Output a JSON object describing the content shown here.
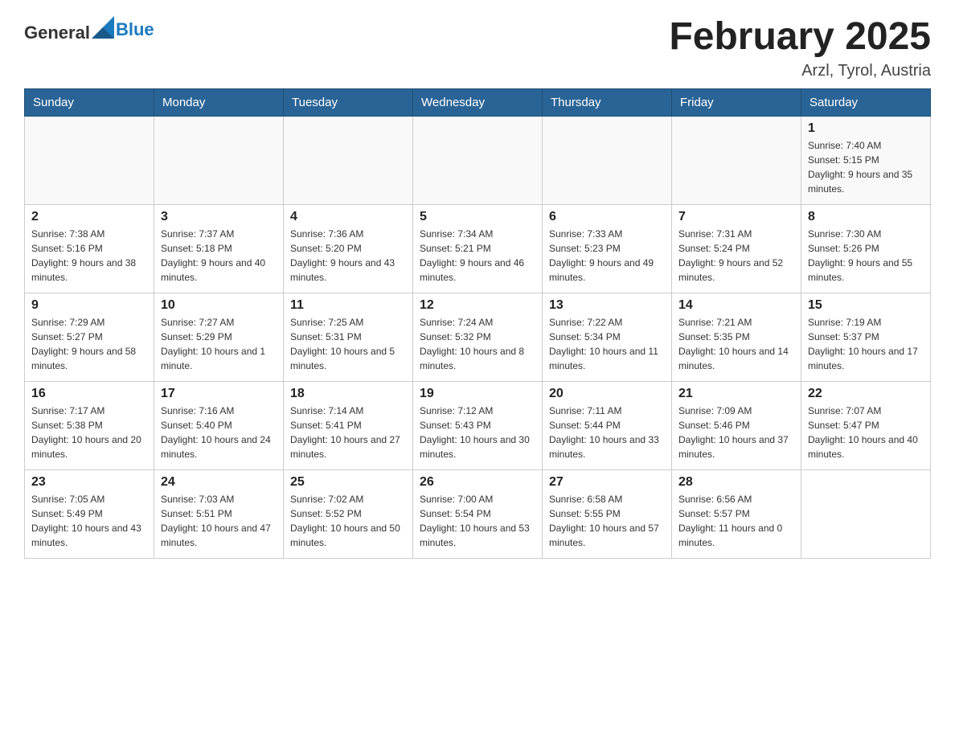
{
  "header": {
    "logo_text_general": "General",
    "logo_text_blue": "Blue",
    "month_title": "February 2025",
    "location": "Arzl, Tyrol, Austria"
  },
  "weekdays": [
    "Sunday",
    "Monday",
    "Tuesday",
    "Wednesday",
    "Thursday",
    "Friday",
    "Saturday"
  ],
  "weeks": [
    [
      {
        "day": "",
        "info": ""
      },
      {
        "day": "",
        "info": ""
      },
      {
        "day": "",
        "info": ""
      },
      {
        "day": "",
        "info": ""
      },
      {
        "day": "",
        "info": ""
      },
      {
        "day": "",
        "info": ""
      },
      {
        "day": "1",
        "info": "Sunrise: 7:40 AM\nSunset: 5:15 PM\nDaylight: 9 hours and 35 minutes."
      }
    ],
    [
      {
        "day": "2",
        "info": "Sunrise: 7:38 AM\nSunset: 5:16 PM\nDaylight: 9 hours and 38 minutes."
      },
      {
        "day": "3",
        "info": "Sunrise: 7:37 AM\nSunset: 5:18 PM\nDaylight: 9 hours and 40 minutes."
      },
      {
        "day": "4",
        "info": "Sunrise: 7:36 AM\nSunset: 5:20 PM\nDaylight: 9 hours and 43 minutes."
      },
      {
        "day": "5",
        "info": "Sunrise: 7:34 AM\nSunset: 5:21 PM\nDaylight: 9 hours and 46 minutes."
      },
      {
        "day": "6",
        "info": "Sunrise: 7:33 AM\nSunset: 5:23 PM\nDaylight: 9 hours and 49 minutes."
      },
      {
        "day": "7",
        "info": "Sunrise: 7:31 AM\nSunset: 5:24 PM\nDaylight: 9 hours and 52 minutes."
      },
      {
        "day": "8",
        "info": "Sunrise: 7:30 AM\nSunset: 5:26 PM\nDaylight: 9 hours and 55 minutes."
      }
    ],
    [
      {
        "day": "9",
        "info": "Sunrise: 7:29 AM\nSunset: 5:27 PM\nDaylight: 9 hours and 58 minutes."
      },
      {
        "day": "10",
        "info": "Sunrise: 7:27 AM\nSunset: 5:29 PM\nDaylight: 10 hours and 1 minute."
      },
      {
        "day": "11",
        "info": "Sunrise: 7:25 AM\nSunset: 5:31 PM\nDaylight: 10 hours and 5 minutes."
      },
      {
        "day": "12",
        "info": "Sunrise: 7:24 AM\nSunset: 5:32 PM\nDaylight: 10 hours and 8 minutes."
      },
      {
        "day": "13",
        "info": "Sunrise: 7:22 AM\nSunset: 5:34 PM\nDaylight: 10 hours and 11 minutes."
      },
      {
        "day": "14",
        "info": "Sunrise: 7:21 AM\nSunset: 5:35 PM\nDaylight: 10 hours and 14 minutes."
      },
      {
        "day": "15",
        "info": "Sunrise: 7:19 AM\nSunset: 5:37 PM\nDaylight: 10 hours and 17 minutes."
      }
    ],
    [
      {
        "day": "16",
        "info": "Sunrise: 7:17 AM\nSunset: 5:38 PM\nDaylight: 10 hours and 20 minutes."
      },
      {
        "day": "17",
        "info": "Sunrise: 7:16 AM\nSunset: 5:40 PM\nDaylight: 10 hours and 24 minutes."
      },
      {
        "day": "18",
        "info": "Sunrise: 7:14 AM\nSunset: 5:41 PM\nDaylight: 10 hours and 27 minutes."
      },
      {
        "day": "19",
        "info": "Sunrise: 7:12 AM\nSunset: 5:43 PM\nDaylight: 10 hours and 30 minutes."
      },
      {
        "day": "20",
        "info": "Sunrise: 7:11 AM\nSunset: 5:44 PM\nDaylight: 10 hours and 33 minutes."
      },
      {
        "day": "21",
        "info": "Sunrise: 7:09 AM\nSunset: 5:46 PM\nDaylight: 10 hours and 37 minutes."
      },
      {
        "day": "22",
        "info": "Sunrise: 7:07 AM\nSunset: 5:47 PM\nDaylight: 10 hours and 40 minutes."
      }
    ],
    [
      {
        "day": "23",
        "info": "Sunrise: 7:05 AM\nSunset: 5:49 PM\nDaylight: 10 hours and 43 minutes."
      },
      {
        "day": "24",
        "info": "Sunrise: 7:03 AM\nSunset: 5:51 PM\nDaylight: 10 hours and 47 minutes."
      },
      {
        "day": "25",
        "info": "Sunrise: 7:02 AM\nSunset: 5:52 PM\nDaylight: 10 hours and 50 minutes."
      },
      {
        "day": "26",
        "info": "Sunrise: 7:00 AM\nSunset: 5:54 PM\nDaylight: 10 hours and 53 minutes."
      },
      {
        "day": "27",
        "info": "Sunrise: 6:58 AM\nSunset: 5:55 PM\nDaylight: 10 hours and 57 minutes."
      },
      {
        "day": "28",
        "info": "Sunrise: 6:56 AM\nSunset: 5:57 PM\nDaylight: 11 hours and 0 minutes."
      },
      {
        "day": "",
        "info": ""
      }
    ]
  ]
}
